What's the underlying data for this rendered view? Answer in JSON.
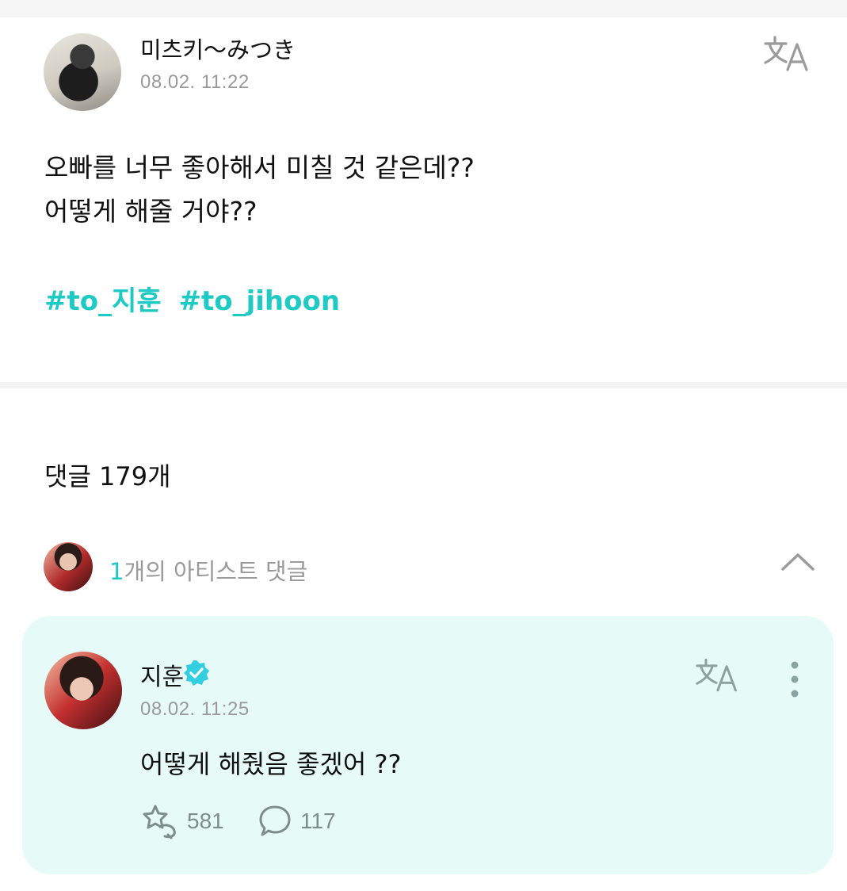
{
  "post": {
    "author": "미츠키〜みつき",
    "time": "08.02. 11:22",
    "body_line1": "오빠를 너무 좋아해서 미칠 것 같은데??",
    "body_line2": "어떻게 해줄 거야??",
    "hashtags": [
      "#to_지훈",
      "#to_jihoon"
    ],
    "translate_icon": "translate-icon"
  },
  "comments": {
    "count_label": "댓글 179개",
    "artist_section": {
      "count": "1",
      "label": "개의 아티스트 댓글",
      "toggle_icon": "chevron-up-icon"
    }
  },
  "artist_comment": {
    "author": "지훈",
    "verified_icon": "verified-badge-icon",
    "time": "08.02. 11:25",
    "text": "어떻게 해줬음 좋겠어 ??",
    "likes": "581",
    "replies": "117",
    "like_icon": "cheer-icon",
    "reply_icon": "speech-bubble-icon",
    "more_icon": "more-vertical-icon"
  },
  "colors": {
    "accent": "#1fc9c4",
    "card_bg": "#e6fbf8",
    "muted_text": "#9a9a9a"
  }
}
